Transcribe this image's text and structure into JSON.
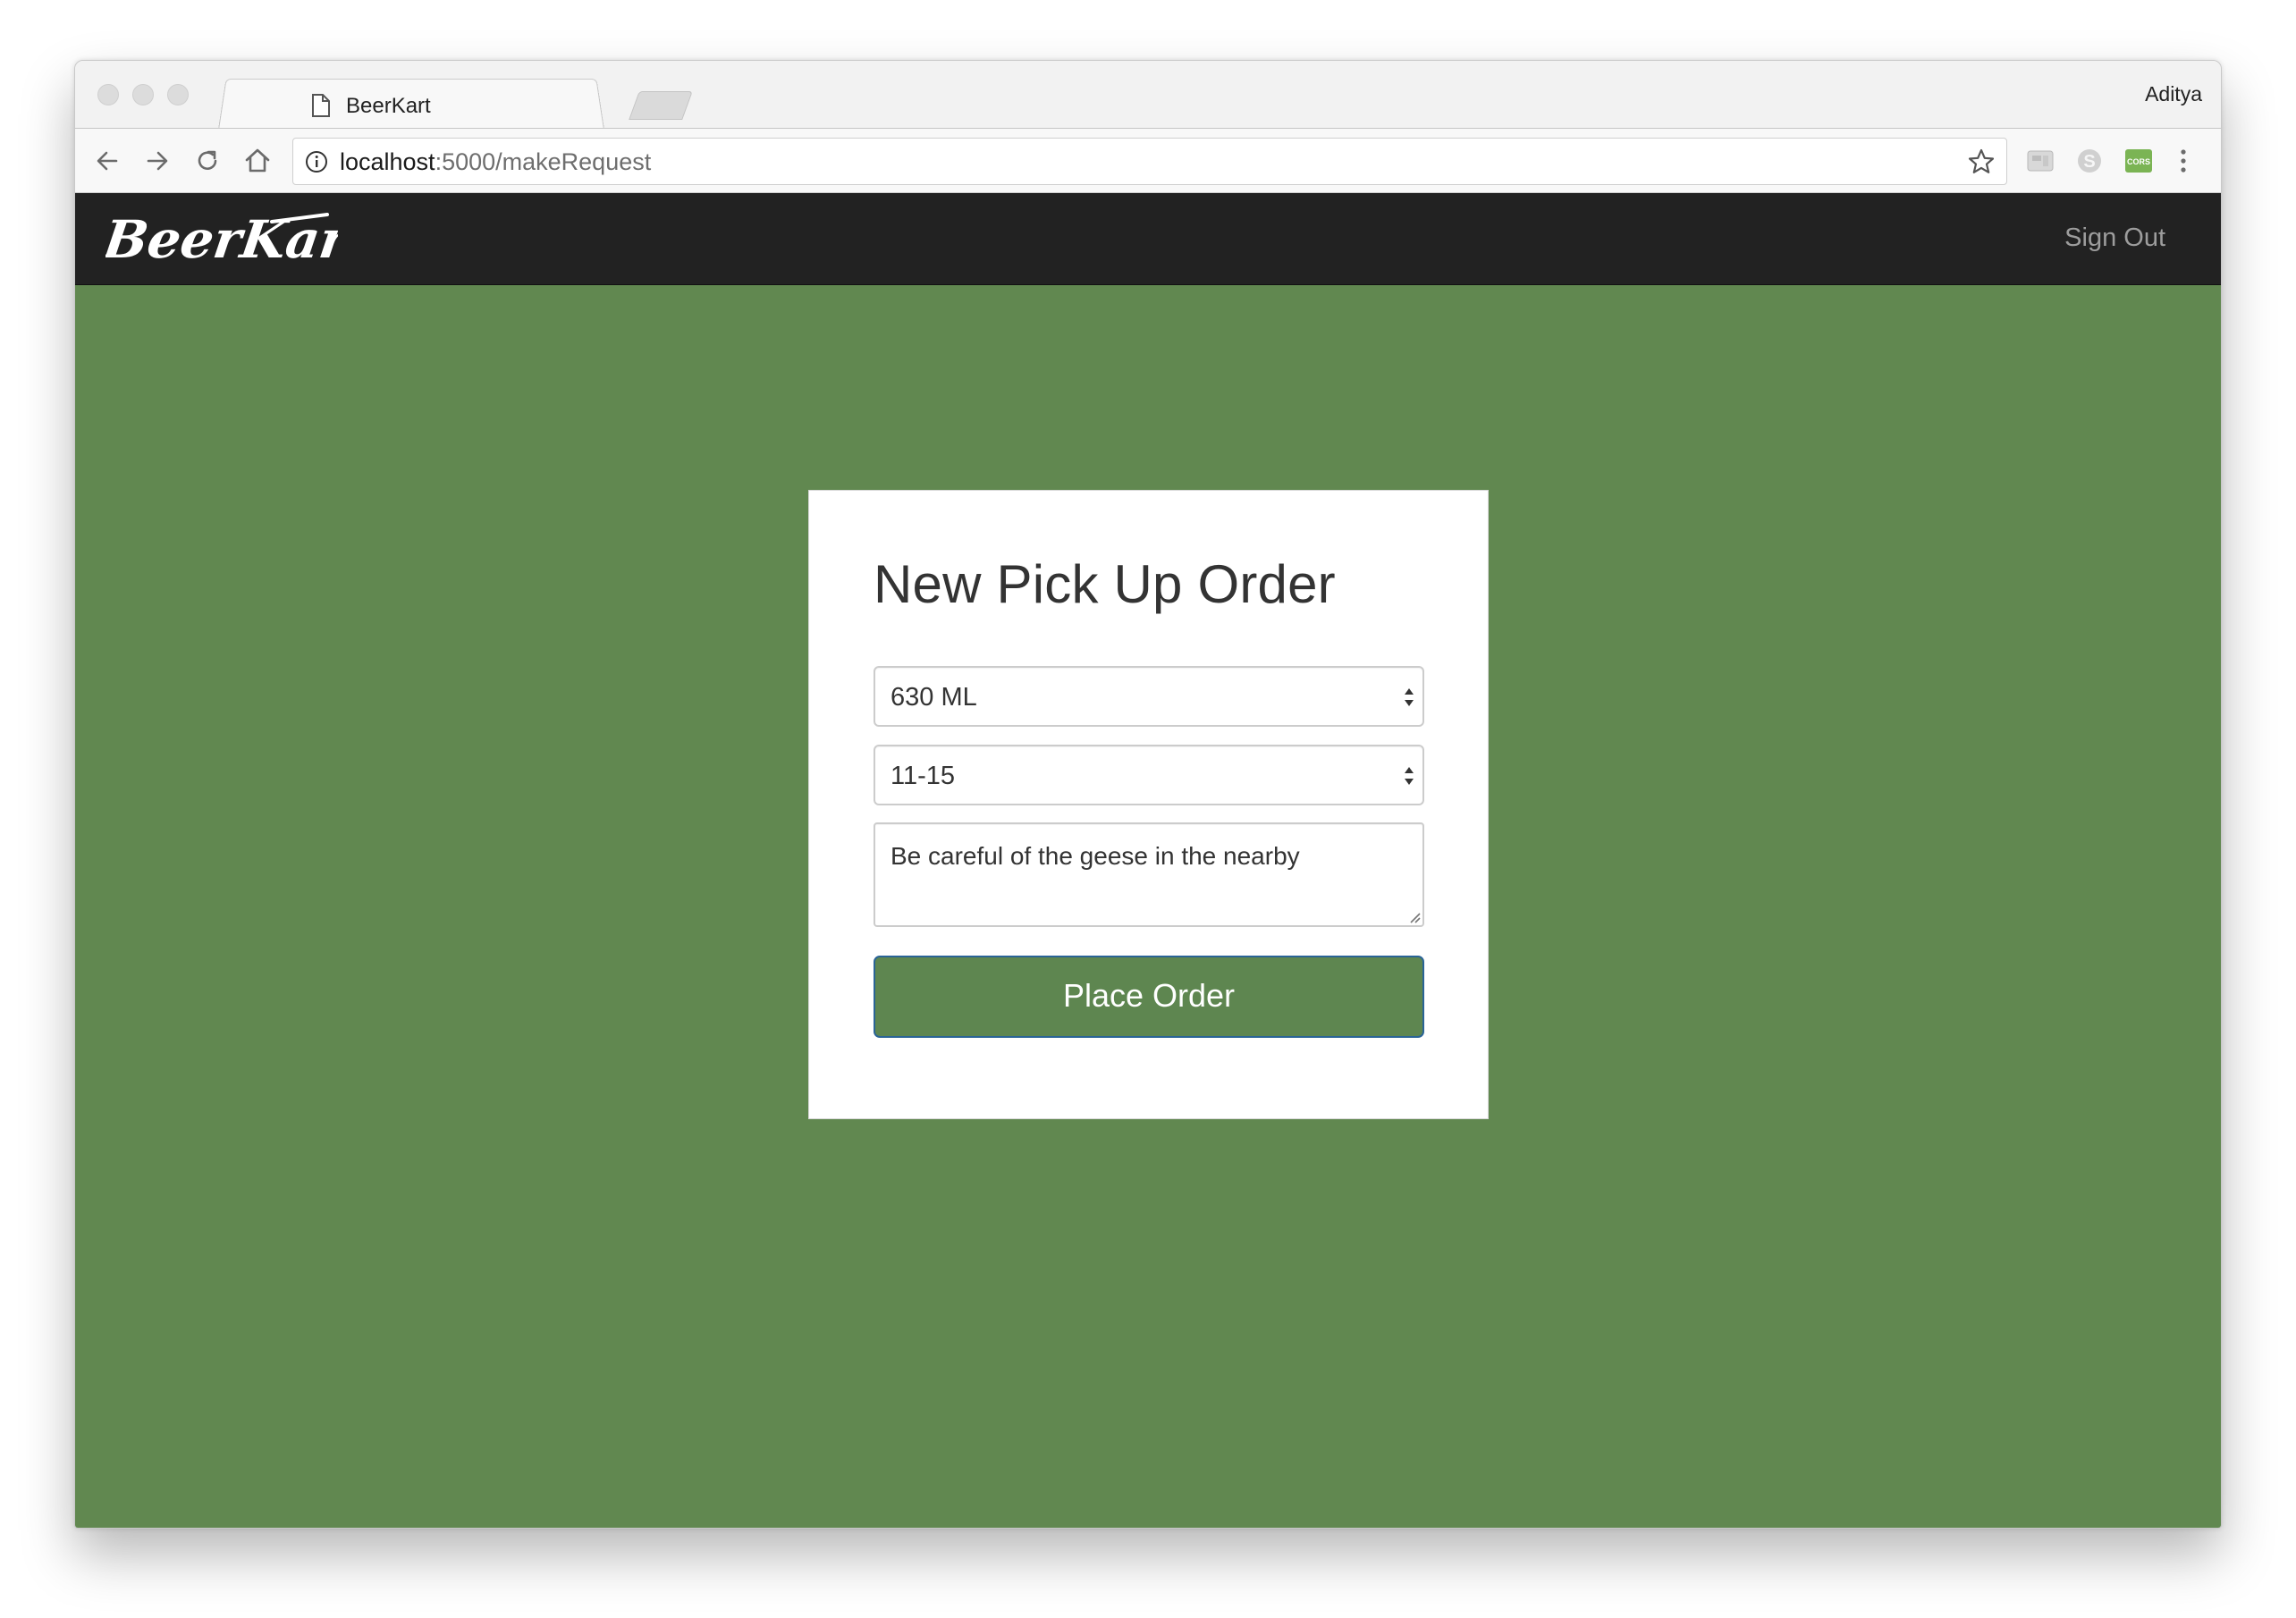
{
  "browser": {
    "tab_title": "BeerKart",
    "tab_close_glyph": "×",
    "profile_name": "Aditya",
    "url_host": "localhost",
    "url_rest": ":5000/makeRequest",
    "icons": [
      "back-arrow-icon",
      "forward-arrow-icon",
      "reload-icon",
      "home-icon",
      "info-icon",
      "star-icon",
      "extension-icon",
      "skype-extension-icon",
      "cors-extension-icon",
      "kebab-menu-icon"
    ],
    "extension_cors_label": "CORS"
  },
  "navbar": {
    "brand": "BeerKart",
    "sign_out": "Sign Out"
  },
  "form": {
    "title": "New Pick Up Order",
    "size_select_value": "630 ML",
    "quantity_select_value": "11-15",
    "notes_value": "Be careful of the geese in the nearby",
    "submit_label": "Place Order"
  },
  "colors": {
    "page_background": "#618850",
    "navbar_background": "#222222",
    "button_background": "#5e8650",
    "button_border": "#2a6496",
    "signout_text": "#9d9d9d"
  }
}
